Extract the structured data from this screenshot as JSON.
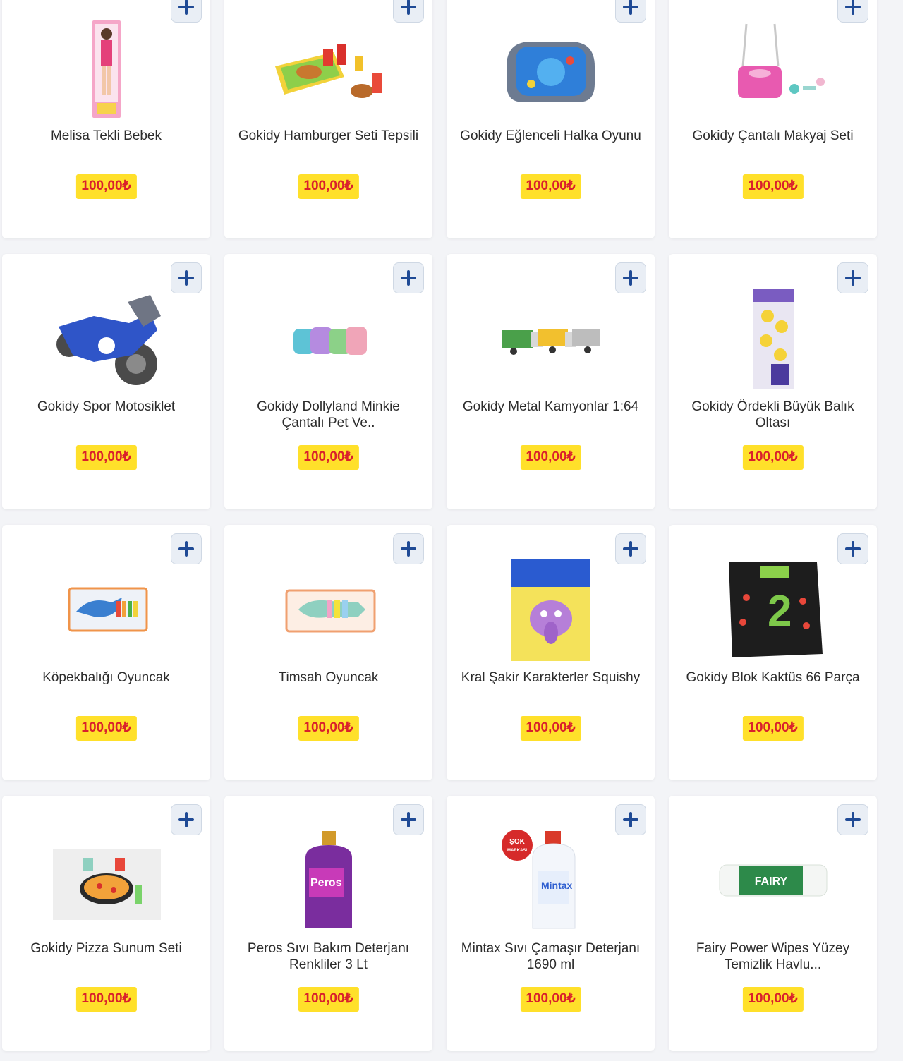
{
  "currency_symbol": "₺",
  "colors": {
    "price_bg": "#ffe02a",
    "price_text": "#d9202c",
    "add_icon": "#1f4a95"
  },
  "products": [
    {
      "name": "Melisa Tekli Bebek",
      "price": "100,00₺",
      "icon": "doll-box"
    },
    {
      "name": "Gokidy Hamburger Seti Tepsili",
      "price": "100,00₺",
      "icon": "burger-tray"
    },
    {
      "name": "Gokidy Eğlenceli Halka Oyunu",
      "price": "100,00₺",
      "icon": "ring-game"
    },
    {
      "name": "Gokidy Çantalı Makyaj Seti",
      "price": "100,00₺",
      "icon": "makeup-bag"
    },
    {
      "name": "Gokidy Spor Motosiklet",
      "price": "100,00₺",
      "icon": "motorcycle"
    },
    {
      "name": "Gokidy Dollyland Minkie Çantalı Pet Ve..",
      "price": "100,00₺",
      "icon": "pet-bags"
    },
    {
      "name": "Gokidy Metal Kamyonlar 1:64",
      "price": "100,00₺",
      "icon": "trucks"
    },
    {
      "name": "Gokidy Ördekli Büyük Balık Oltası",
      "price": "100,00₺",
      "icon": "fishing-ducks"
    },
    {
      "name": "Köpekbalığı Oyuncak",
      "price": "100,00₺",
      "icon": "shark-box"
    },
    {
      "name": "Timsah Oyuncak",
      "price": "100,00₺",
      "icon": "crocodile-box"
    },
    {
      "name": "Kral Şakir Karakterler Squishy",
      "price": "100,00₺",
      "icon": "squishy-card"
    },
    {
      "name": "Gokidy Blok Kaktüs 66 Parça",
      "price": "100,00₺",
      "icon": "cactus-box"
    },
    {
      "name": "Gokidy Pizza Sunum Seti",
      "price": "100,00₺",
      "icon": "pizza-set"
    },
    {
      "name": "Peros Sıvı Bakım Deterjanı Renkliler 3 Lt",
      "price": "100,00₺",
      "icon": "peros-bottle"
    },
    {
      "name": "Mintax Sıvı Çamaşır Deterjanı 1690 ml",
      "price": "100,00₺",
      "icon": "mintax-bottle"
    },
    {
      "name": "Fairy Power Wipes Yüzey Temizlik Havlu...",
      "price": "100,00₺",
      "icon": "fairy-wipes"
    }
  ],
  "badges": {
    "sok_markasi_line1": "ŞOK",
    "sok_markasi_line2": "MARKASI"
  },
  "image_labels": {
    "peros": "Peros",
    "mintax": "Mintax",
    "fairy": "FAIRY",
    "block_number": "2"
  }
}
